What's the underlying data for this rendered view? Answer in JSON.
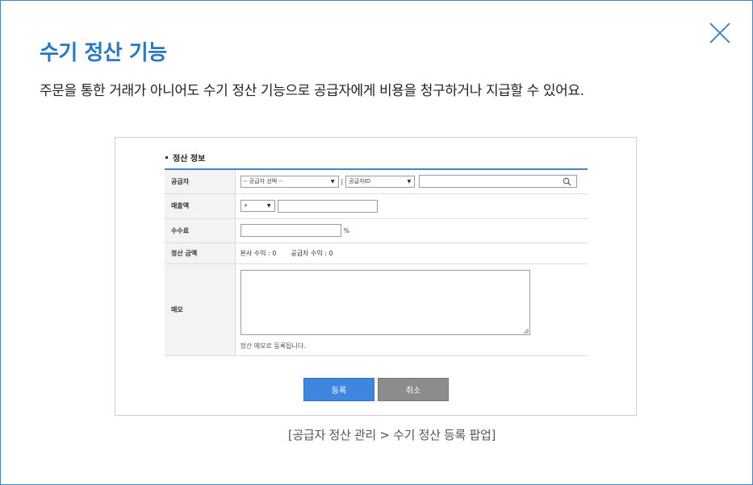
{
  "header": {
    "title": "수기 정산 기능",
    "description": "주문을 통한 거래가 아니어도 수기 정산 기능으로 공급자에게 비용을 청구하거나 지급할 수 있어요."
  },
  "screenshot": {
    "section_title": "정산 정보",
    "rows": {
      "supplier": {
        "label": "공급자",
        "select_value": "-- 공급자 선택 --",
        "separator": "|",
        "id_select_value": "공급자ID"
      },
      "sales": {
        "label": "매출액",
        "sign_value": "+"
      },
      "fee": {
        "label": "수수료",
        "unit": "%"
      },
      "settlement": {
        "label": "정산 금액",
        "hq_profit": "본사 수익 : 0",
        "supplier_profit": "공급자 수익 : 0"
      },
      "memo": {
        "label": "메모",
        "hint": "정산 메모로 등록됩니다."
      }
    },
    "buttons": {
      "register": "등록",
      "cancel": "취소"
    }
  },
  "caption": "[공급자 정산 관리 > 수기 정산 등록 팝업]",
  "colors": {
    "accent": "#3f86c7",
    "title": "#2a78c5",
    "primary_button": "#3f86e0",
    "cancel_button": "#8c8c8c"
  }
}
